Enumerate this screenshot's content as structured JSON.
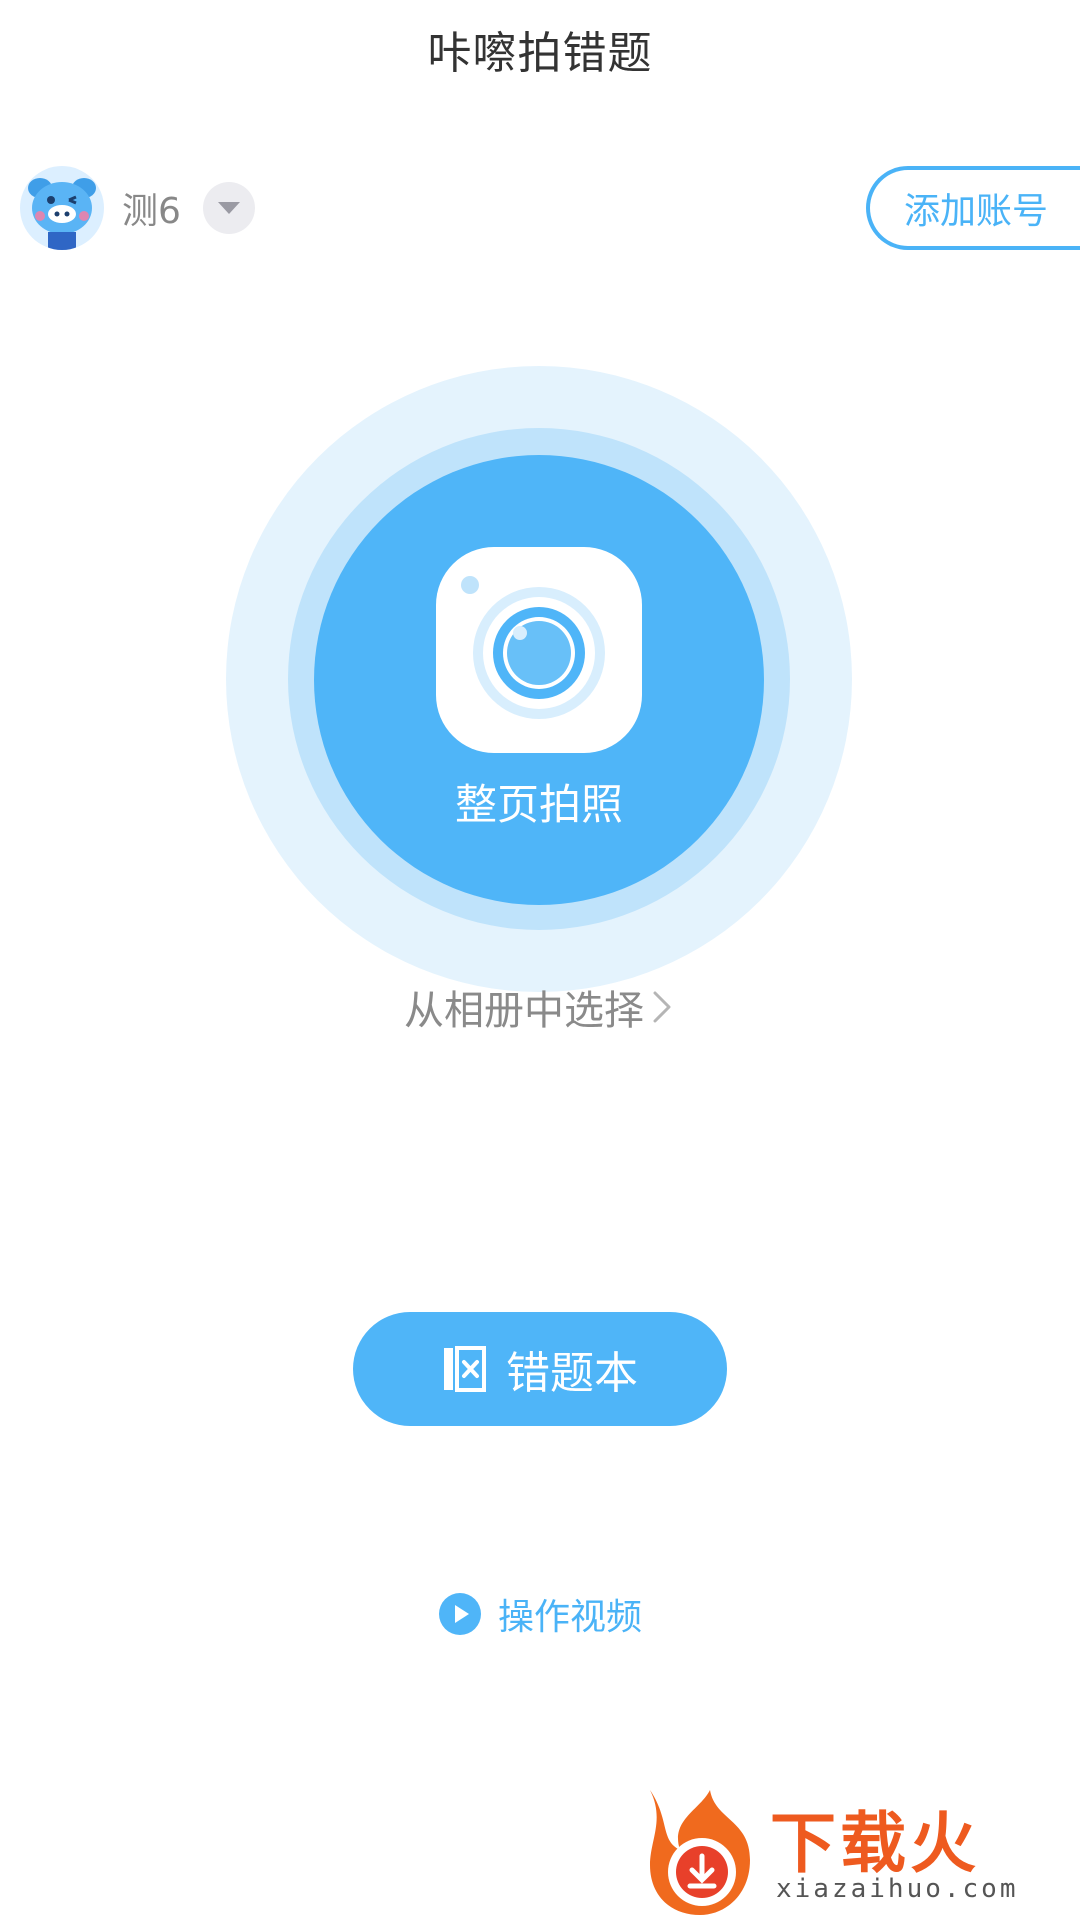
{
  "header": {
    "title": "咔嚓拍错题"
  },
  "account": {
    "name": "测6",
    "add_account_label": "添加账号",
    "avatar_icon": "pig-mascot-icon",
    "dropdown_icon": "triangle-down-icon"
  },
  "capture": {
    "label": "整页拍照",
    "icon": "camera-icon"
  },
  "album": {
    "label": "从相册中选择",
    "icon": "chevron-right-icon"
  },
  "mistake_book": {
    "label": "错题本",
    "icon": "book-icon"
  },
  "tutorial": {
    "label": "操作视频",
    "icon": "play-circle-icon"
  },
  "watermark": {
    "brand": "下载火",
    "url": "xiazaihuo.com"
  },
  "colors": {
    "accent": "#4fb5f8",
    "ring_outer": "#e4f3fd",
    "ring_mid": "#bfe3fb",
    "title_text": "#333333",
    "muted_text": "#888888",
    "watermark": "#ee5a1f"
  }
}
